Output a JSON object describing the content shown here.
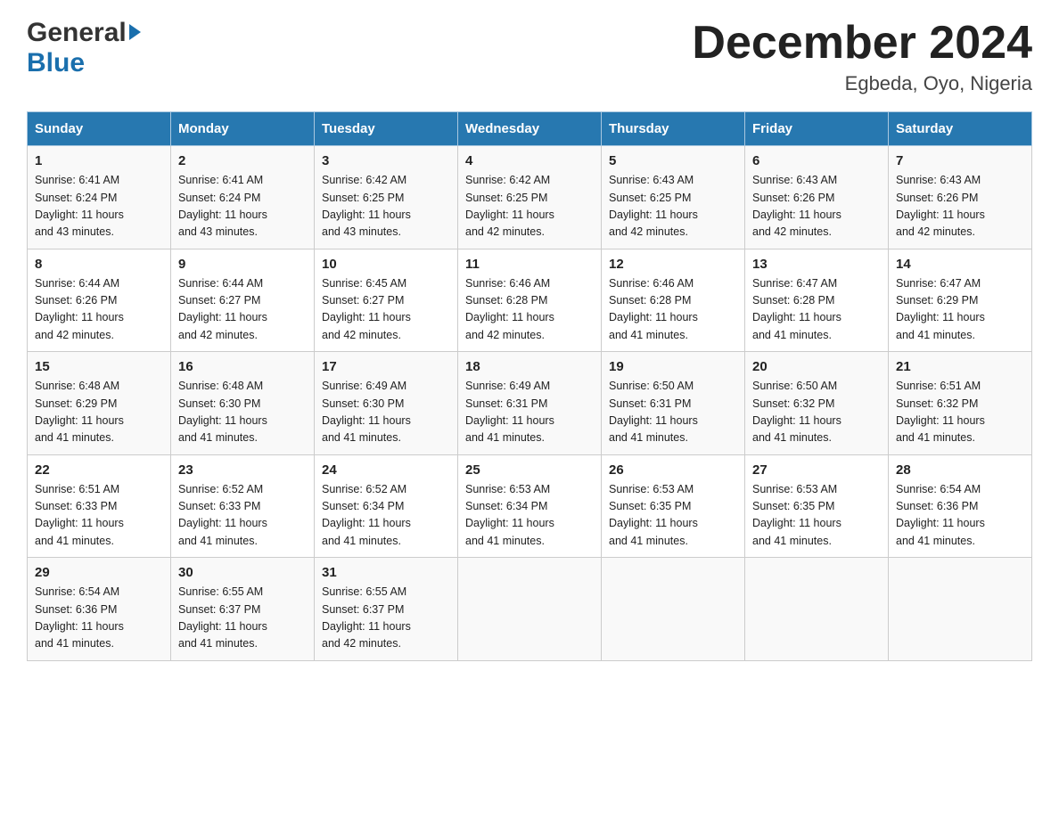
{
  "logo": {
    "general": "General",
    "blue": "Blue",
    "arrow": "▶"
  },
  "title": "December 2024",
  "subtitle": "Egbeda, Oyo, Nigeria",
  "columns": [
    "Sunday",
    "Monday",
    "Tuesday",
    "Wednesday",
    "Thursday",
    "Friday",
    "Saturday"
  ],
  "weeks": [
    [
      {
        "day": "1",
        "sunrise": "6:41 AM",
        "sunset": "6:24 PM",
        "daylight": "11 hours and 43 minutes."
      },
      {
        "day": "2",
        "sunrise": "6:41 AM",
        "sunset": "6:24 PM",
        "daylight": "11 hours and 43 minutes."
      },
      {
        "day": "3",
        "sunrise": "6:42 AM",
        "sunset": "6:25 PM",
        "daylight": "11 hours and 43 minutes."
      },
      {
        "day": "4",
        "sunrise": "6:42 AM",
        "sunset": "6:25 PM",
        "daylight": "11 hours and 42 minutes."
      },
      {
        "day": "5",
        "sunrise": "6:43 AM",
        "sunset": "6:25 PM",
        "daylight": "11 hours and 42 minutes."
      },
      {
        "day": "6",
        "sunrise": "6:43 AM",
        "sunset": "6:26 PM",
        "daylight": "11 hours and 42 minutes."
      },
      {
        "day": "7",
        "sunrise": "6:43 AM",
        "sunset": "6:26 PM",
        "daylight": "11 hours and 42 minutes."
      }
    ],
    [
      {
        "day": "8",
        "sunrise": "6:44 AM",
        "sunset": "6:26 PM",
        "daylight": "11 hours and 42 minutes."
      },
      {
        "day": "9",
        "sunrise": "6:44 AM",
        "sunset": "6:27 PM",
        "daylight": "11 hours and 42 minutes."
      },
      {
        "day": "10",
        "sunrise": "6:45 AM",
        "sunset": "6:27 PM",
        "daylight": "11 hours and 42 minutes."
      },
      {
        "day": "11",
        "sunrise": "6:46 AM",
        "sunset": "6:28 PM",
        "daylight": "11 hours and 42 minutes."
      },
      {
        "day": "12",
        "sunrise": "6:46 AM",
        "sunset": "6:28 PM",
        "daylight": "11 hours and 41 minutes."
      },
      {
        "day": "13",
        "sunrise": "6:47 AM",
        "sunset": "6:28 PM",
        "daylight": "11 hours and 41 minutes."
      },
      {
        "day": "14",
        "sunrise": "6:47 AM",
        "sunset": "6:29 PM",
        "daylight": "11 hours and 41 minutes."
      }
    ],
    [
      {
        "day": "15",
        "sunrise": "6:48 AM",
        "sunset": "6:29 PM",
        "daylight": "11 hours and 41 minutes."
      },
      {
        "day": "16",
        "sunrise": "6:48 AM",
        "sunset": "6:30 PM",
        "daylight": "11 hours and 41 minutes."
      },
      {
        "day": "17",
        "sunrise": "6:49 AM",
        "sunset": "6:30 PM",
        "daylight": "11 hours and 41 minutes."
      },
      {
        "day": "18",
        "sunrise": "6:49 AM",
        "sunset": "6:31 PM",
        "daylight": "11 hours and 41 minutes."
      },
      {
        "day": "19",
        "sunrise": "6:50 AM",
        "sunset": "6:31 PM",
        "daylight": "11 hours and 41 minutes."
      },
      {
        "day": "20",
        "sunrise": "6:50 AM",
        "sunset": "6:32 PM",
        "daylight": "11 hours and 41 minutes."
      },
      {
        "day": "21",
        "sunrise": "6:51 AM",
        "sunset": "6:32 PM",
        "daylight": "11 hours and 41 minutes."
      }
    ],
    [
      {
        "day": "22",
        "sunrise": "6:51 AM",
        "sunset": "6:33 PM",
        "daylight": "11 hours and 41 minutes."
      },
      {
        "day": "23",
        "sunrise": "6:52 AM",
        "sunset": "6:33 PM",
        "daylight": "11 hours and 41 minutes."
      },
      {
        "day": "24",
        "sunrise": "6:52 AM",
        "sunset": "6:34 PM",
        "daylight": "11 hours and 41 minutes."
      },
      {
        "day": "25",
        "sunrise": "6:53 AM",
        "sunset": "6:34 PM",
        "daylight": "11 hours and 41 minutes."
      },
      {
        "day": "26",
        "sunrise": "6:53 AM",
        "sunset": "6:35 PM",
        "daylight": "11 hours and 41 minutes."
      },
      {
        "day": "27",
        "sunrise": "6:53 AM",
        "sunset": "6:35 PM",
        "daylight": "11 hours and 41 minutes."
      },
      {
        "day": "28",
        "sunrise": "6:54 AM",
        "sunset": "6:36 PM",
        "daylight": "11 hours and 41 minutes."
      }
    ],
    [
      {
        "day": "29",
        "sunrise": "6:54 AM",
        "sunset": "6:36 PM",
        "daylight": "11 hours and 41 minutes."
      },
      {
        "day": "30",
        "sunrise": "6:55 AM",
        "sunset": "6:37 PM",
        "daylight": "11 hours and 41 minutes."
      },
      {
        "day": "31",
        "sunrise": "6:55 AM",
        "sunset": "6:37 PM",
        "daylight": "11 hours and 42 minutes."
      },
      {
        "day": "",
        "sunrise": "",
        "sunset": "",
        "daylight": ""
      },
      {
        "day": "",
        "sunrise": "",
        "sunset": "",
        "daylight": ""
      },
      {
        "day": "",
        "sunrise": "",
        "sunset": "",
        "daylight": ""
      },
      {
        "day": "",
        "sunrise": "",
        "sunset": "",
        "daylight": ""
      }
    ]
  ],
  "labels": {
    "sunrise": "Sunrise:",
    "sunset": "Sunset:",
    "daylight": "Daylight:"
  }
}
